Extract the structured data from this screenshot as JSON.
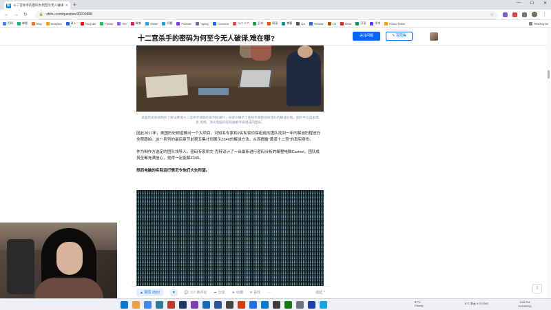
{
  "browser": {
    "tab_title": "十二宫杀手的密码为何至今无人破译",
    "url": "zhihu.com/question/30200988",
    "window_controls": [
      "—",
      "☐",
      "✕"
    ]
  },
  "bookmarks": [
    {
      "label": "百科",
      "color": "#3b82f6"
    },
    {
      "label": "神搜",
      "color": "#10b981"
    },
    {
      "label": "blog",
      "color": "#f97316"
    },
    {
      "label": "Analytics",
      "color": "#f59e0b"
    },
    {
      "label": "录入",
      "color": "#2563eb"
    },
    {
      "label": "YouTube",
      "color": "#ff0000"
    },
    {
      "label": "Feedly",
      "color": "#22c55e"
    },
    {
      "label": "RM",
      "color": "#8b5cf6"
    },
    {
      "label": "微博",
      "color": "#e11d48"
    },
    {
      "label": "Twitter",
      "color": "#1da1f2"
    },
    {
      "label": "问题",
      "color": "#0ea5e9"
    },
    {
      "label": "Podcast",
      "color": "#7c3aed"
    },
    {
      "label": "Typing",
      "color": "#64748b"
    },
    {
      "label": "Coursera",
      "color": "#2563eb"
    },
    {
      "label": "コバンク",
      "color": "#ef4444"
    },
    {
      "label": "日本",
      "color": "#16a34a"
    },
    {
      "label": "阅读",
      "color": "#ea580c"
    },
    {
      "label": "博客",
      "color": "#0891b2"
    },
    {
      "label": "QA",
      "color": "#475569"
    },
    {
      "label": "Scholar",
      "color": "#2563eb"
    },
    {
      "label": "Lib",
      "color": "#a16207"
    },
    {
      "label": "news",
      "color": "#dc2626"
    },
    {
      "label": "汉语",
      "color": "#059669"
    },
    {
      "label": "学术",
      "color": "#4f46e5"
    },
    {
      "label": "iCloud Notes",
      "color": "#f59e0b"
    }
  ],
  "reading_list_label": "Reading list",
  "question_header": {
    "title": "十二宫杀手的密码为何至今无人破译,难在哪?",
    "follow_label": "关注问题",
    "answer_label": "✎ 写回答"
  },
  "article": {
    "caption": "美国历史频道制作了解读黄道十二宫杀手谜题的系列纪录片，向观众展示了密码专家和侦探团队的解谜过程。图片中正是由黑克·克特、顶尖电脑的密码破解专家组成的团队。",
    "para1": "因此2017年，美国历史频道推出一个大项目，对知名专家和2名私家侦探组成的团队找到一年的解谜历程进行全程跟拍。这一系列的最后章节前第五集计划展示Z340的解谜方法，从而揭露“黄道十二宫”的真实身份。",
    "para2": "作为制作方选定的团队领导人，密码专家凯文·克特设计了一台最新进行密码分析的编程电脑Carmel，团队成员全都充满信心，觉得一定能解Z340。",
    "para3": "然而电脑的实际运行情况令他们大失所望。"
  },
  "actions": {
    "upvote": "▲ 赞同 2583",
    "downvote": "▼",
    "comments": "117 条评论",
    "share": "分享",
    "favorite": "收藏",
    "like": "喜欢",
    "more": "···",
    "collapse": "收起 ^"
  },
  "taskbar": {
    "weather_temp": "37°C",
    "weather_desc": "Cloudy",
    "tray_text": "6°C 多云  ∧  ⊡  ENG",
    "time": "9:52 PM",
    "date": "10/19/2021"
  }
}
